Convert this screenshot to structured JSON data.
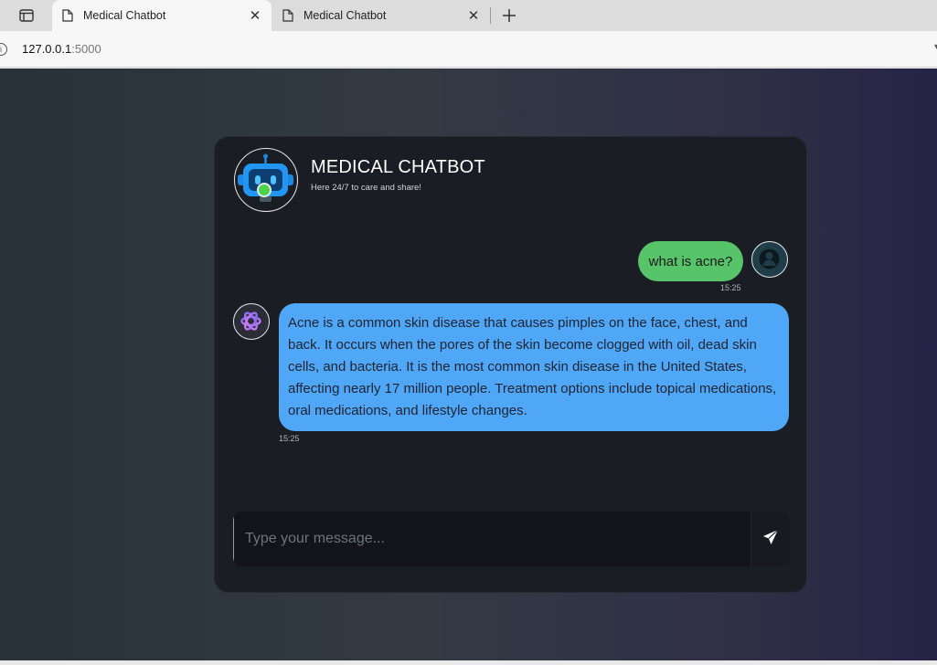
{
  "browser": {
    "tabs": [
      {
        "title": "Medical Chatbot",
        "active": true
      },
      {
        "title": "Medical Chatbot",
        "active": false
      }
    ],
    "url_host": "127.0.0.1",
    "url_port": ":5000"
  },
  "chat": {
    "title": "MEDICAL CHATBOT",
    "subtitle": "Here 24/7 to care and share!",
    "messages": [
      {
        "sender": "user",
        "text": "what is acne?",
        "time": "15:25"
      },
      {
        "sender": "bot",
        "text": "Acne is a common skin disease that causes pimples on the face, chest, and back. It occurs when the pores of the skin become clogged with oil, dead skin cells, and bacteria. It is the most common skin disease in the United States, affecting nearly 17 million people. Treatment options include topical medications, oral medications, and lifestyle changes.",
        "time": "15:25"
      }
    ],
    "input": {
      "placeholder": "Type your message...",
      "value": ""
    }
  },
  "colors": {
    "user_bubble": "#58c46a",
    "bot_bubble": "#50a6f7",
    "online_status": "#4bd34b",
    "card_background": "#1b1d24"
  },
  "icons": {
    "tab_switcher": "tab-switcher-icon",
    "tab_page": "document-icon",
    "close": "close-icon",
    "new_tab": "plus-icon",
    "site_info": "info-icon",
    "bot_avatar": "robot-icon",
    "user_avatar": "user-icon",
    "ai_avatar": "openai-logo-icon",
    "send": "paper-plane-icon"
  }
}
